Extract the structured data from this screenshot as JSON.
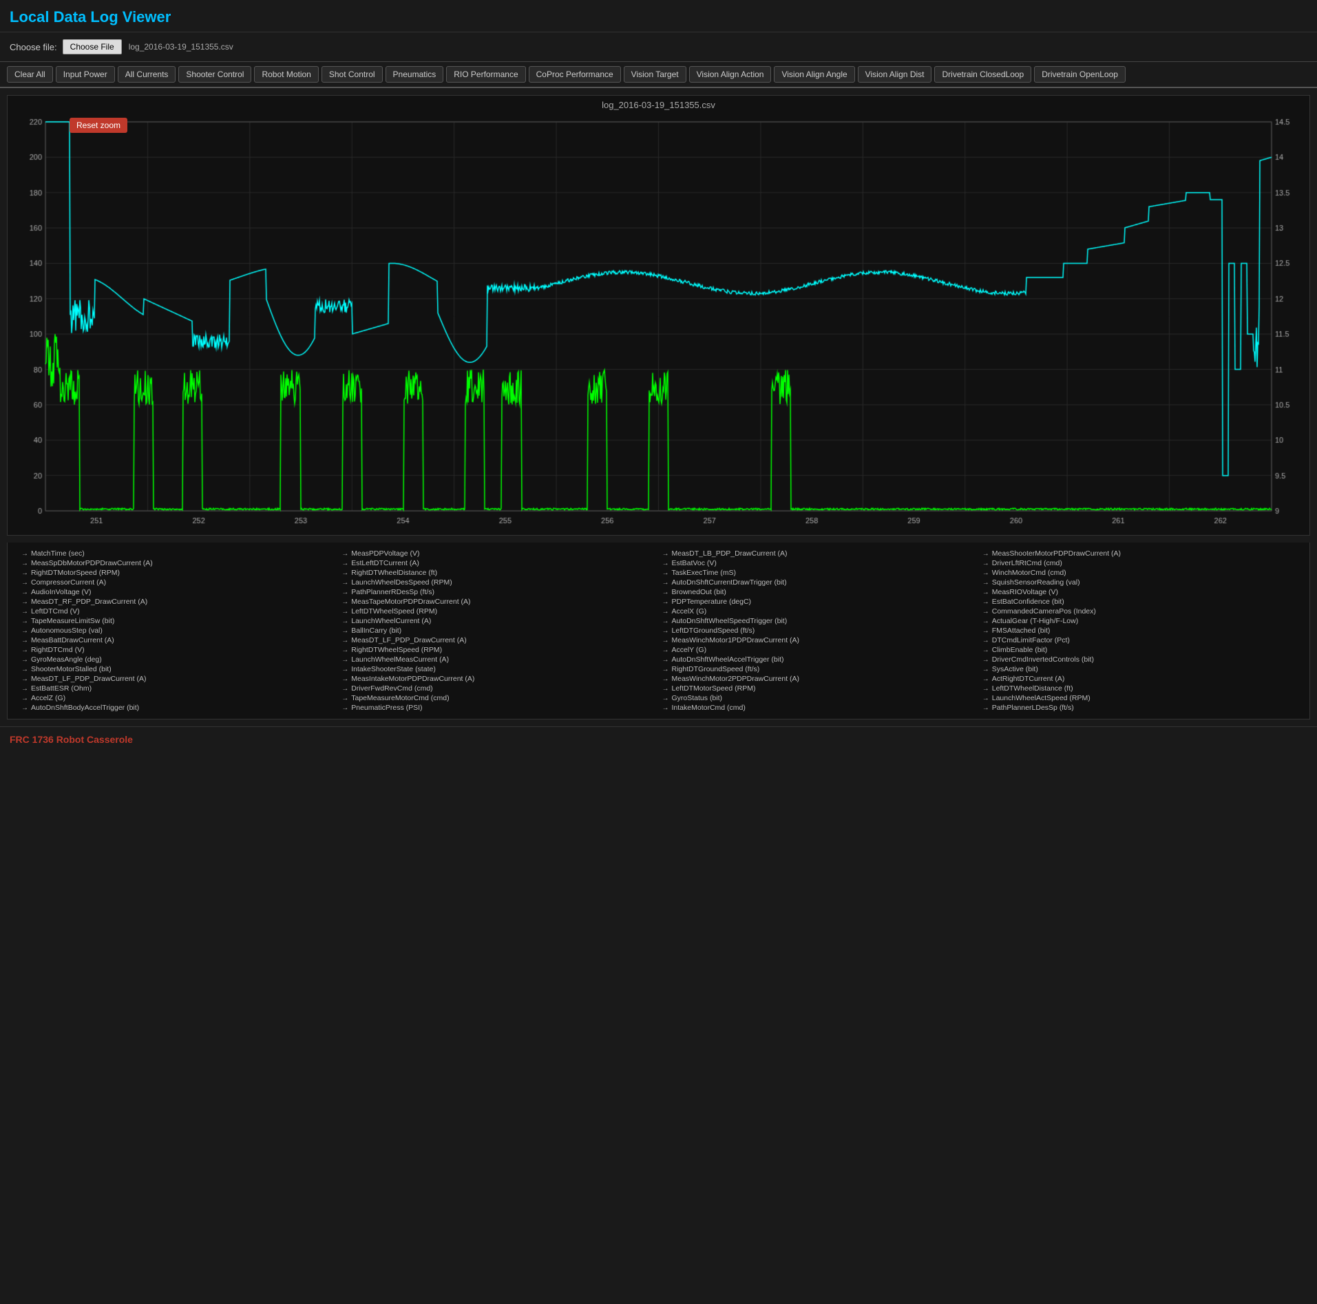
{
  "app": {
    "title": "Local Data Log Viewer",
    "footer": "FRC 1736 Robot Casserole"
  },
  "file": {
    "label": "Choose file:",
    "button": "Choose File",
    "current": "log_2016-03-19_151355.csv"
  },
  "toolbar": {
    "buttons": [
      "Clear All",
      "Input Power",
      "All Currents",
      "Shooter Control",
      "Robot Motion",
      "Shot Control",
      "Pneumatics",
      "RIO Performance",
      "CoProc Performance",
      "Vision Target",
      "Vision Align Action",
      "Vision Align Angle",
      "Vision Align Dist",
      "Drivetrain ClosedLoop",
      "Drivetrain OpenLoop"
    ]
  },
  "chart": {
    "title": "log_2016-03-19_151355.csv",
    "reset_zoom": "Reset zoom",
    "y_left": [
      "220",
      "200",
      "180",
      "160",
      "140",
      "120",
      "100",
      "80",
      "60",
      "40",
      "20",
      "0"
    ],
    "y_right": [
      "14.5",
      "14",
      "13.5",
      "13",
      "12.5",
      "12",
      "11.5",
      "11",
      "10.5",
      "10",
      "9.5",
      "9"
    ],
    "x_labels": [
      "251",
      "252",
      "253",
      "254",
      "255",
      "256",
      "257",
      "258",
      "259",
      "260",
      "261",
      "262"
    ],
    "nav_left": "<",
    "nav_right": ">"
  },
  "legend": {
    "items": [
      "MatchTime (sec)",
      "MeasPDPVoltage (V)",
      "MeasDT_LB_PDP_DrawCurrent (A)",
      "MeasShooterMotorPDPDrawCurrent (A)",
      "MeasSpDbMotorPDPDrawCurrent (A)",
      "EstLeftDTCurrent (A)",
      "EstBatVoc (V)",
      "DriverLftRtCmd (cmd)",
      "RightDTMotorSpeed (RPM)",
      "RightDTWheelDistance (ft)",
      "TaskExecTime (mS)",
      "WinchMotorCmd (cmd)",
      "CompressorCurrent (A)",
      "LaunchWheelDesSpeed (RPM)",
      "AutoDnShftCurrentDrawTrigger (bit)",
      "SquishSensorReading (val)",
      "AudioInVoltage (V)",
      "PathPlannerRDesSp (ft/s)",
      "BrownedOut (bit)",
      "MeasRIOVoltage (V)",
      "MeasDT_RF_PDP_DrawCurrent (A)",
      "MeasTapeMotorPDPDrawCurrent (A)",
      "PDPTemperature (degC)",
      "EstBatConfidence (bit)",
      "LeftDTCmd (V)",
      "LeftDTWheelSpeed (RPM)",
      "AccelX (G)",
      "CommandedCameraPos (Index)",
      "TapeMeasureLimitSw (bit)",
      "LaunchWheelCurrent (A)",
      "AutoDnShftWheelSpeedTrigger (bit)",
      "ActualGear (T-High/F-Low)",
      "AutonomousStep (val)",
      "BallInCarry (bit)",
      "LeftDTGroundSpeed (ft/s)",
      "FMSAttached (bit)",
      "MeasBattDrawCurrent (A)",
      "MeasDT_LF_PDP_DrawCurrent (A)",
      "MeasWinchMotor1PDPDrawCurrent (A)",
      "DTCmdLimitFactor (Pct)",
      "RightDTCmd (V)",
      "RightDTWheelSpeed (RPM)",
      "AccelY (G)",
      "ClimbEnable (bit)",
      "GyroMeasAngle (deg)",
      "LaunchWheelMeasCurrent (A)",
      "AutoDnShftWheelAccelTrigger (bit)",
      "DriverCmdInvertedControls (bit)",
      "ShooterMotorStalled (bit)",
      "IntakeShooterState (state)",
      "RightDTGroundSpeed (ft/s)",
      "SysActive (bit)",
      "MeasDT_LF_PDP_DrawCurrent (A)",
      "MeasIntakeMotorPDPDrawCurrent (A)",
      "MeasWinchMotor2PDPDrawCurrent (A)",
      "ActRightDTCurrent (A)",
      "EstBattESR (Ohm)",
      "DriverFwdRevCmd (cmd)",
      "LeftDTMotorSpeed (RPM)",
      "LeftDTWheelDistance (ft)",
      "AccelZ (G)",
      "TapeMeasureMotorCmd (cmd)",
      "GyroStatus (bit)",
      "LaunchWheelActSpeed (RPM)",
      "AutoDnShftBodyAccelTrigger (bit)",
      "PneumaticPress (PSI)",
      "IntakeMotorCmd (cmd)",
      "PathPlannerLDesSp (ft/s)"
    ]
  }
}
